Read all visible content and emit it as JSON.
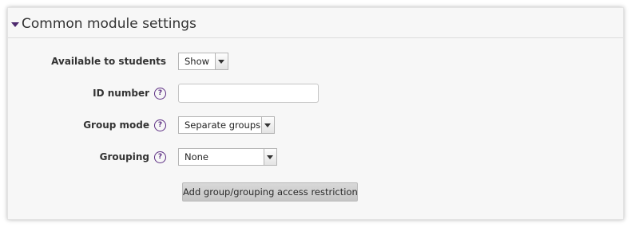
{
  "section": {
    "title": "Common module settings",
    "expanded": true
  },
  "fields": {
    "visibility": {
      "label": "Available to students",
      "selected": "Show"
    },
    "idnumber": {
      "label": "ID number",
      "value": "",
      "help_icon": "question-icon"
    },
    "groupmode": {
      "label": "Group mode",
      "selected": "Separate groups",
      "help_icon": "question-icon"
    },
    "grouping": {
      "label": "Grouping",
      "selected": "None",
      "help_icon": "question-icon"
    }
  },
  "actions": {
    "add_restriction_label": "Add group/grouping access restriction"
  },
  "colors": {
    "accent": "#5b2c82",
    "panel_background": "#f7f7f7",
    "button_background": "#cfcfcf"
  }
}
